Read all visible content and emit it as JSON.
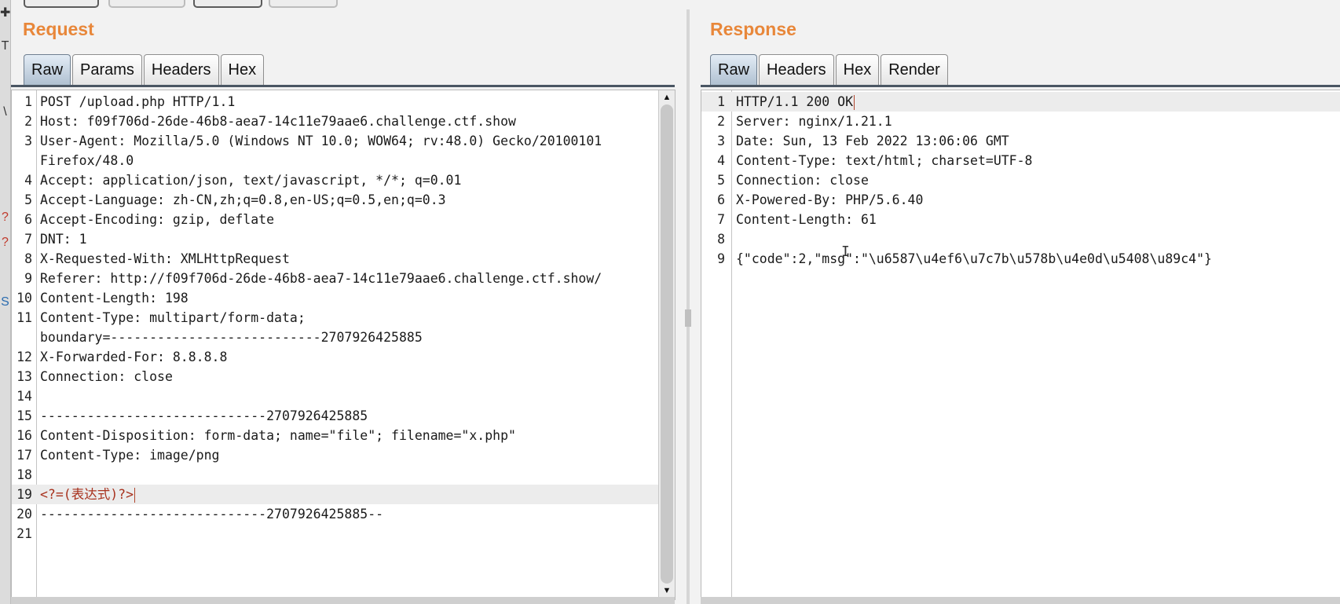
{
  "left_glyphs": [
    "✚",
    "T",
    "\\",
    "?",
    "?",
    "S"
  ],
  "request": {
    "title": "Request",
    "tabs": [
      "Raw",
      "Params",
      "Headers",
      "Hex"
    ],
    "active_tab": "Raw",
    "lines": [
      {
        "n": "1",
        "text": "POST /upload.php HTTP/1.1"
      },
      {
        "n": "2",
        "text": "Host: f09f706d-26de-46b8-aea7-14c11e79aae6.challenge.ctf.show"
      },
      {
        "n": "3",
        "text": "User-Agent: Mozilla/5.0 (Windows NT 10.0; WOW64; rv:48.0) Gecko/20100101"
      },
      {
        "n": "",
        "text": "Firefox/48.0"
      },
      {
        "n": "4",
        "text": "Accept: application/json, text/javascript, */*; q=0.01"
      },
      {
        "n": "5",
        "text": "Accept-Language: zh-CN,zh;q=0.8,en-US;q=0.5,en;q=0.3"
      },
      {
        "n": "6",
        "text": "Accept-Encoding: gzip, deflate"
      },
      {
        "n": "7",
        "text": "DNT: 1"
      },
      {
        "n": "8",
        "text": "X-Requested-With: XMLHttpRequest"
      },
      {
        "n": "9",
        "text": "Referer: http://f09f706d-26de-46b8-aea7-14c11e79aae6.challenge.ctf.show/"
      },
      {
        "n": "10",
        "text": "Content-Length: 198"
      },
      {
        "n": "11",
        "text": "Content-Type: multipart/form-data;"
      },
      {
        "n": "",
        "text": "boundary=---------------------------2707926425885"
      },
      {
        "n": "12",
        "text": "X-Forwarded-For: 8.8.8.8"
      },
      {
        "n": "13",
        "text": "Connection: close"
      },
      {
        "n": "14",
        "text": ""
      },
      {
        "n": "15",
        "text": "-----------------------------2707926425885"
      },
      {
        "n": "16",
        "text": "Content-Disposition: form-data; name=\"file\"; filename=\"x.php\""
      },
      {
        "n": "17",
        "text": "Content-Type: image/png"
      },
      {
        "n": "18",
        "text": ""
      },
      {
        "n": "19",
        "text": "<?=(表达式)?>"
      },
      {
        "n": "20",
        "text": "-----------------------------2707926425885--"
      },
      {
        "n": "21",
        "text": ""
      }
    ]
  },
  "response": {
    "title": "Response",
    "tabs": [
      "Raw",
      "Headers",
      "Hex",
      "Render"
    ],
    "active_tab": "Raw",
    "lines": [
      {
        "n": "1",
        "text": "HTTP/1.1 200 OK"
      },
      {
        "n": "2",
        "text": "Server: nginx/1.21.1"
      },
      {
        "n": "3",
        "text": "Date: Sun, 13 Feb 2022 13:06:06 GMT"
      },
      {
        "n": "4",
        "text": "Content-Type: text/html; charset=UTF-8"
      },
      {
        "n": "5",
        "text": "Connection: close"
      },
      {
        "n": "6",
        "text": "X-Powered-By: PHP/5.6.40"
      },
      {
        "n": "7",
        "text": "Content-Length: 61"
      },
      {
        "n": "8",
        "text": ""
      },
      {
        "n": "9",
        "text": "{\"code\":2,\"msg\":\"\\u6587\\u4ef6\\u7c7b\\u578b\\u4e0d\\u5408\\u89c4\"}"
      }
    ]
  },
  "colors": {
    "title_orange": "#e8873a",
    "active_tab": "#aebfd0",
    "php_code_red": "#a8321e"
  }
}
